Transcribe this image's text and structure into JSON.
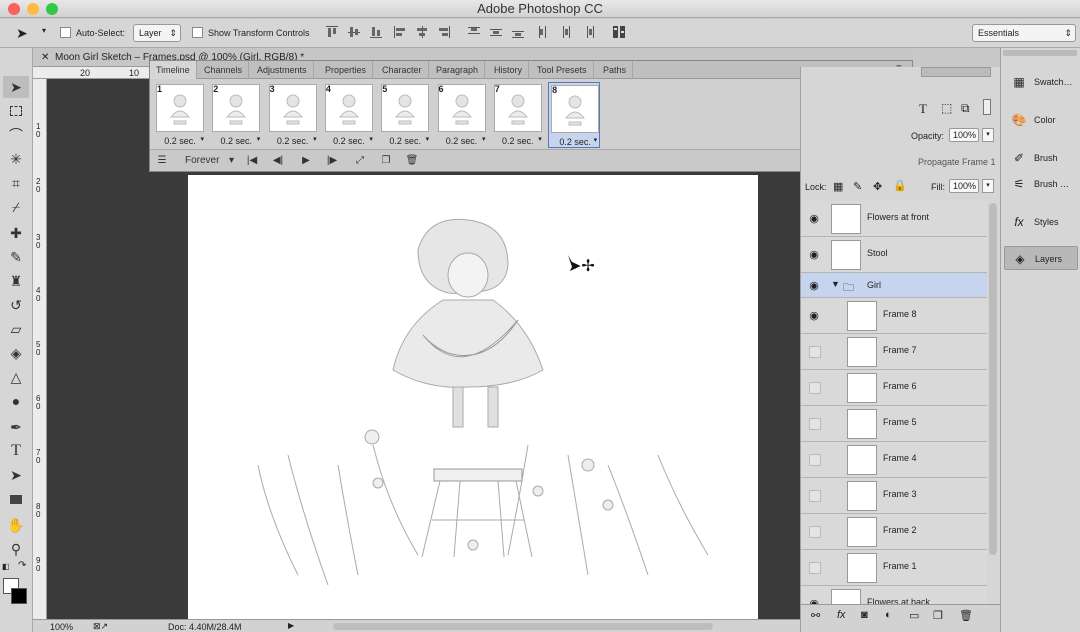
{
  "app": {
    "title": "Adobe Photoshop CC"
  },
  "options_bar": {
    "auto_select_label": "Auto-Select:",
    "auto_select_value": "Layer",
    "show_transform_label": "Show Transform Controls",
    "workspace": "Essentials"
  },
  "document": {
    "tab_title": "Moon Girl Sketch – Frames.psd @ 100% (Girl, RGB/8) *",
    "zoom": "100%",
    "doc_size": "Doc: 4.40M/28.4M"
  },
  "rulers": {
    "h": [
      "20",
      "10"
    ],
    "v": [
      "1\n0",
      "2\n0",
      "3\n0",
      "4\n0",
      "5\n0",
      "6\n0",
      "7\n0",
      "8\n0",
      "9\n0"
    ]
  },
  "timeline": {
    "tabs": [
      "Timeline",
      "Channels",
      "Adjustments",
      "Properties",
      "Character",
      "Paragraph",
      "History",
      "Tool Presets",
      "Paths"
    ],
    "frames": [
      {
        "num": "1",
        "delay": "0.2 sec."
      },
      {
        "num": "2",
        "delay": "0.2 sec."
      },
      {
        "num": "3",
        "delay": "0.2 sec."
      },
      {
        "num": "4",
        "delay": "0.2 sec."
      },
      {
        "num": "5",
        "delay": "0.2 sec."
      },
      {
        "num": "6",
        "delay": "0.2 sec."
      },
      {
        "num": "7",
        "delay": "0.2 sec."
      },
      {
        "num": "8",
        "delay": "0.2 sec."
      }
    ],
    "selected_frame": "8",
    "loop": "Forever"
  },
  "layers_panel": {
    "opacity_label": "Opacity:",
    "opacity_value": "100%",
    "propagate_label": "Propagate Frame 1",
    "lock_label": "Lock:",
    "fill_label": "Fill:",
    "fill_value": "100%",
    "layers": [
      {
        "name": "Flowers at front",
        "visible": true
      },
      {
        "name": "Stool",
        "visible": true
      },
      {
        "name": "Girl",
        "visible": true,
        "group": true
      },
      {
        "name": "Frame 8",
        "visible": true
      },
      {
        "name": "Frame 7",
        "visible": false
      },
      {
        "name": "Frame 6",
        "visible": false
      },
      {
        "name": "Frame 5",
        "visible": false
      },
      {
        "name": "Frame 4",
        "visible": false
      },
      {
        "name": "Frame 3",
        "visible": false
      },
      {
        "name": "Frame 2",
        "visible": false
      },
      {
        "name": "Frame 1",
        "visible": false
      },
      {
        "name": "Flowers at back",
        "visible": true
      }
    ]
  },
  "right_dock": {
    "items": [
      "Swatch…",
      "Color",
      "Brush",
      "Brush …",
      "Styles",
      "Layers"
    ],
    "active": "Layers"
  },
  "colors": {
    "selection": "#c6d4ee",
    "pasteboard": "#3a3a3a"
  }
}
